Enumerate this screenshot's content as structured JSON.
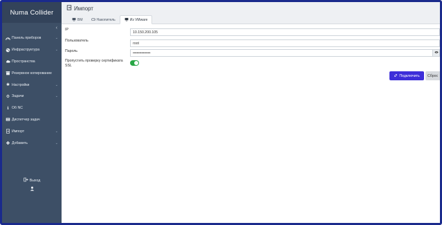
{
  "sidebar": {
    "brand": "Numa Collider",
    "items": [
      {
        "label": "Панель приборов",
        "icon": "dashboard-icon",
        "has_chevron": true
      },
      {
        "label": "Инфраструктура",
        "icon": "globe-icon",
        "has_chevron": true
      },
      {
        "label": "Пространства",
        "icon": "cloud-icon",
        "has_chevron": false
      },
      {
        "label": "Резервное копирование",
        "icon": "archive-icon",
        "has_chevron": false
      },
      {
        "label": "Настройки",
        "icon": "gear-icon",
        "has_chevron": true
      },
      {
        "label": "Задачи",
        "icon": "gears-icon",
        "has_chevron": true
      },
      {
        "label": "Об NC",
        "icon": "info-icon",
        "has_chevron": false
      },
      {
        "label": "Диспетчер задач",
        "icon": "tasks-icon",
        "has_chevron": false
      },
      {
        "label": "Импорт",
        "icon": "file-import-icon",
        "has_chevron": true
      },
      {
        "label": "Добавить",
        "icon": "plus-icon",
        "has_chevron": true
      }
    ],
    "logout_label": "Выход"
  },
  "header": {
    "title": "Импорт",
    "tabs": [
      {
        "label": "ВМ",
        "icon": "monitor-icon",
        "active": false
      },
      {
        "label": "Накопитель",
        "icon": "disk-icon",
        "active": false
      },
      {
        "label": "Из VMware",
        "icon": "monitor-icon",
        "active": true
      }
    ]
  },
  "form": {
    "ip_label": "IP",
    "ip_value": "10.150.200.105",
    "user_label": "Пользователь",
    "user_value": "root",
    "password_label": "Пароль",
    "password_value": "••••••••••••••",
    "skip_ssl_label": "Пропустить проверку сертификата SSL",
    "skip_ssl_enabled": true,
    "connect_label": "Подключить",
    "reset_label": "Сброс"
  },
  "colors": {
    "sidebar_bg": "#3d4f66",
    "brand_bg": "#33435a",
    "primary_button": "#3d2ed9",
    "toggle_on": "#28a745",
    "frame_border": "#1a2a8c"
  }
}
